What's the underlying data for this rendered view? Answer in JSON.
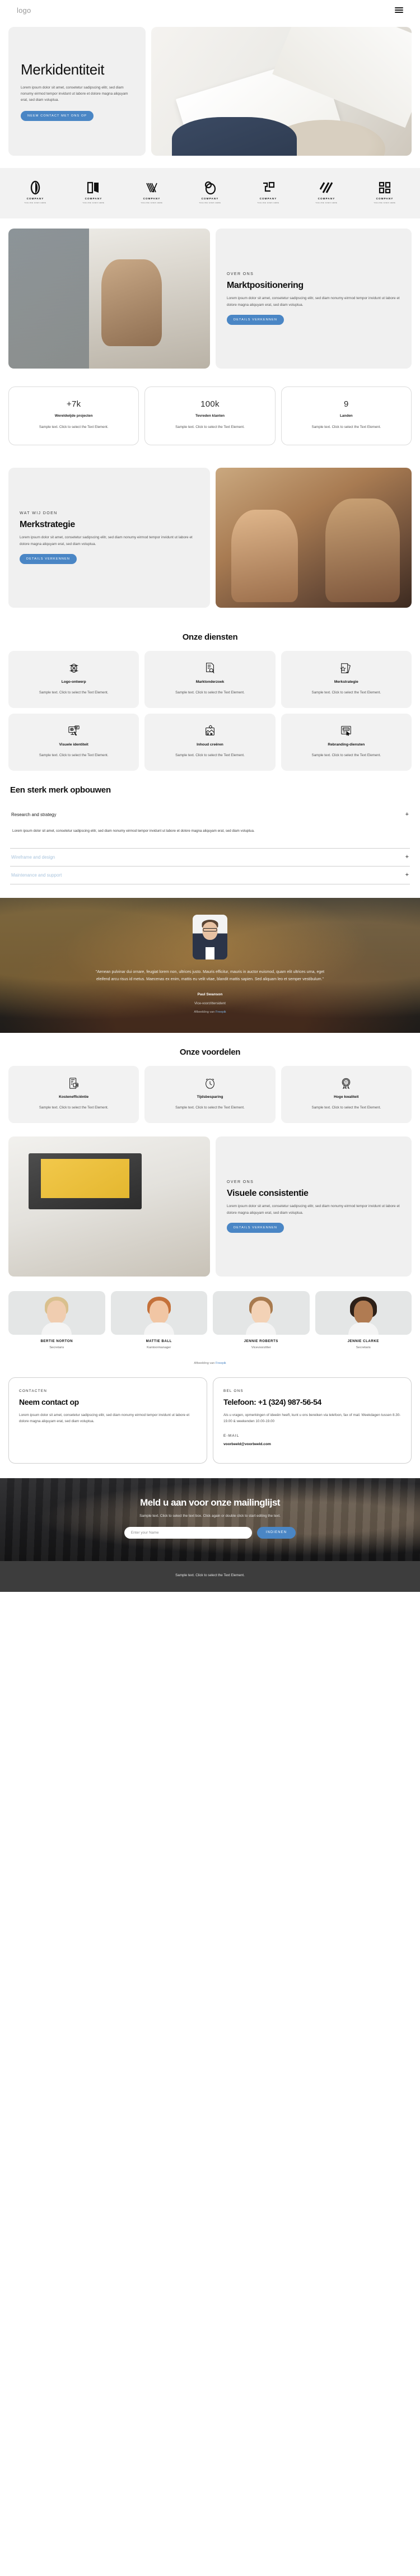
{
  "header": {
    "logo": "logo",
    "menu_icon": "hamburger-menu-icon"
  },
  "hero": {
    "title": "Merkidentiteit",
    "text": "Lorem ipsum dolor sit amet, consetetur sadipscing elitr, sed diam nonumy eirmod tempor invidunt ut labore et dolore magna aliquyam erat, sed diam voluptua.",
    "cta": "NEEM CONTACT MET ONS OP"
  },
  "clients": [
    {
      "name": "COMPANY",
      "tagline": "TAGLINE GOES HERE"
    },
    {
      "name": "COMPANY",
      "tagline": "TAGLINE GOES HERE"
    },
    {
      "name": "COMPANY",
      "tagline": "TAGLINE GOES HERE"
    },
    {
      "name": "COMPANY",
      "tagline": "TAGLINE GOES HERE"
    },
    {
      "name": "COMPANY",
      "tagline": "TAGLINE GOES HERE"
    },
    {
      "name": "COMPANY",
      "tagline": "TAGLINE GOES HERE"
    },
    {
      "name": "COMPANY",
      "tagline": "TAGLINE GOES HERE"
    }
  ],
  "about": {
    "eyebrow": "OVER ONS",
    "title": "Marktpositionering",
    "text": "Lorem ipsum dolor sit amet, consetetur sadipscing elitr, sed diam nonumy eirmod tempor invidunt ut labore et dolore magna aliquyam erat, sed diam voluptua.",
    "cta": "DETAILS VERKENNEN"
  },
  "stats": [
    {
      "value": "+7k",
      "label": "Wereldwijde projecten",
      "desc": "Sample text. Click to select the Text Element."
    },
    {
      "value": "100k",
      "label": "Tevreden klanten",
      "desc": "Sample text. Click to select the Text Element."
    },
    {
      "value": "9",
      "label": "Landen",
      "desc": "Sample text. Click to select the Text Element."
    }
  ],
  "strategy": {
    "eyebrow": "WAT WIJ DOEN",
    "title": "Merkstrategie",
    "text": "Lorem ipsum dolor sit amet, consetetur sadipscing elitr, sed diam nonumy eirmod tempor invidunt ut labore et dolore magna aliquyam erat, sed diam voluptua.",
    "cta": "DETAILS VERKENNEN"
  },
  "services": {
    "title": "Onze diensten",
    "items": [
      {
        "icon": "logo-design-icon",
        "title": "Logo-ontwerp",
        "desc": "Sample text. Click to select the Text Element."
      },
      {
        "icon": "market-research-icon",
        "title": "Marktonderzoek",
        "desc": "Sample text. Click to select the Text Element."
      },
      {
        "icon": "brand-strategy-icon",
        "title": "Merkstrategie",
        "desc": "Sample text. Click to select the Text Element."
      },
      {
        "icon": "visual-identity-icon",
        "title": "Visuele identiteit",
        "desc": "Sample text. Click to select the Text Element."
      },
      {
        "icon": "content-creation-icon",
        "title": "Inhoud creëren",
        "desc": "Sample text. Click to select the Text Element."
      },
      {
        "icon": "rebranding-icon",
        "title": "Rebranding-diensten",
        "desc": "Sample text. Click to select the Text Element."
      }
    ]
  },
  "accordion": {
    "title": "Een sterk merk opbouwen",
    "items": [
      {
        "label": "Research and strategy",
        "open": true,
        "body": "Lorem ipsum dolor sit amet, consetetur sadipscing elitr, sed diam nonumy eirmod tempor invidunt ut labore et dolore magna aliquyam erat, sed diam voluptua.",
        "toggle": "+"
      },
      {
        "label": "Wireframe and design",
        "open": false,
        "body": "",
        "toggle": "+"
      },
      {
        "label": "Maintenance and support",
        "open": false,
        "body": "",
        "toggle": "+"
      }
    ]
  },
  "testimonial": {
    "quote": "\"Aenean pulvinar dui ornare, feugiat lorem non, ultrices justo. Mauris efficitur, mauris in auctor euismod, quam elit ultrices urna, eget eleifend arcu risus id metus. Maecenas ex enim, mattis eu velit vitae, blandit mattis sapien. Sed aliquam leo et semper vestibulum.\"",
    "name": "Paul Swanson",
    "role": "Vice-voorzittersident",
    "credit_prefix": "Afbeelding van ",
    "credit_link": "Freepik"
  },
  "benefits": {
    "title": "Onze voordelen",
    "items": [
      {
        "icon": "cost-efficiency-icon",
        "title": "Kostenefficiëntie",
        "desc": "Sample text. Click to select the Text Element."
      },
      {
        "icon": "time-saving-icon",
        "title": "Tijdsbesparing",
        "desc": "Sample text. Click to select the Text Element."
      },
      {
        "icon": "high-quality-icon",
        "title": "Hoge kwaliteit",
        "desc": "Sample text. Click to select the Text Element."
      }
    ]
  },
  "consistency": {
    "eyebrow": "OVER ONS",
    "title": "Visuele consistentie",
    "text": "Lorem ipsum dolor sit amet, consetetur sadipscing elitr, sed diam nonumy eirmod tempor invidunt ut labore et dolore magna aliquyam erat, sed diam voluptua.",
    "cta": "DETAILS VERKENNEN"
  },
  "team": {
    "credit_prefix": "Afbeelding van ",
    "credit_link": "Freepik",
    "members": [
      {
        "name": "BERTIE NORTON",
        "role": "Secretaris"
      },
      {
        "name": "MATTIE BALL",
        "role": "Kantoormanager"
      },
      {
        "name": "JENNIE ROBERTS",
        "role": "Vicevoorzitter"
      },
      {
        "name": "JENNIE CLARKE",
        "role": "Secretaris"
      }
    ]
  },
  "contact": {
    "left": {
      "eyebrow": "CONTACTEN",
      "title": "Neem contact op",
      "text": "Lorem ipsum dolor sit amet, consetetur sadipscing elitr, sed diam nonumy eirmod tempor invidunt ut labore et dolore magna aliquyam erat, sed diam voluptua."
    },
    "right": {
      "eyebrow": "BEL ONS",
      "title": "Telefoon: +1 (324) 987-56-54",
      "text": "Als u vragen, opmerkingen of ideeën heeft, kunt u ons bereiken via telefoon, fax of mail. Weekdagen tussen 8.30-19.00 & weekenden 10.00-19.00",
      "email_label": "E-MAIL",
      "email": "voorbeeld@voorbeeld.com"
    }
  },
  "newsletter": {
    "title": "Meld u aan voor onze mailinglijst",
    "subtitle": "Sample text. Click to select the text box. Click again or double click to start editing the text.",
    "placeholder": "Enter your Name",
    "button": "INDIENEN"
  },
  "footer": {
    "text": "Sample text. Click to select the Text Element."
  },
  "colors": {
    "accent": "#4a86c5",
    "surface": "#f0f0f0",
    "footer_bg": "#3d3d3d"
  }
}
